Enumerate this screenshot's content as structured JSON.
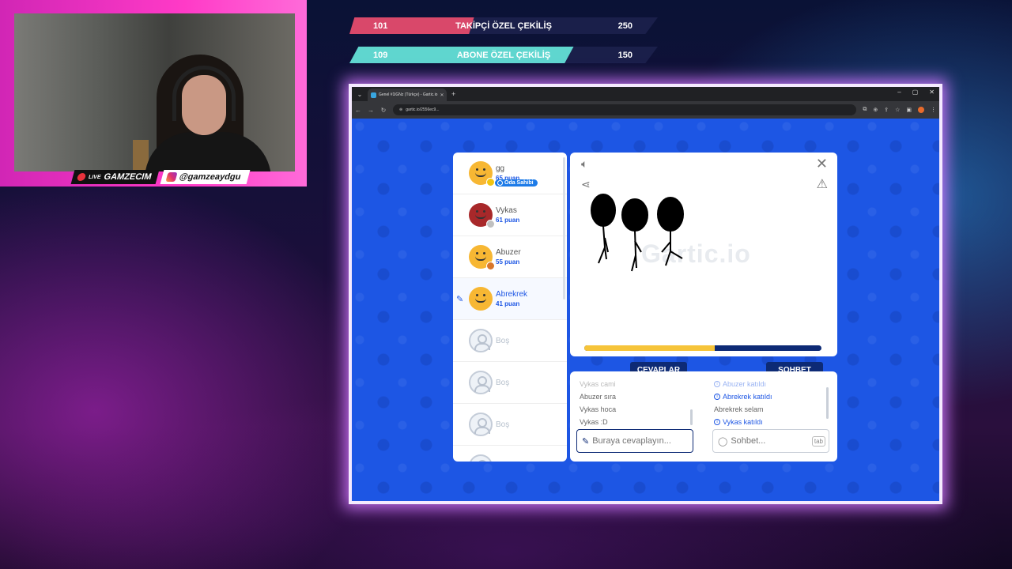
{
  "webcam": {
    "streamer_name": "GAMZECIM",
    "live_label": "LIVE",
    "instagram_handle": "@gamzeaydgu"
  },
  "ribbons": [
    {
      "left_value": "101",
      "title": "TAKİPÇİ ÖZEL ÇEKİLİŞ",
      "right_value": "250",
      "color": "#d9486a",
      "progress": 0.404
    },
    {
      "left_value": "109",
      "title": "ABONE ÖZEL ÇEKİLİŞ",
      "right_value": "150",
      "color": "#5fd6cf",
      "progress": 0.727
    }
  ],
  "browser": {
    "tab_title": "Genel #1lGNz (Türkçe) - Gartic.io",
    "url": "gartic.io/2556ec9..."
  },
  "players": [
    {
      "name": "gg",
      "score": "65 puan",
      "avatar_color": "#f7b733",
      "badge_color": "#f2c511",
      "owner_label": "Oda Sahibi"
    },
    {
      "name": "Vykas",
      "score": "61 puan",
      "avatar_color": "#a8282a",
      "badge_color": "#c0c0c0"
    },
    {
      "name": "Abuzer",
      "score": "55 puan",
      "avatar_color": "#f7b733",
      "badge_color": "#d9772a"
    },
    {
      "name": "Abrekrek",
      "score": "41 puan",
      "avatar_color": "#f7b733",
      "badge_color": "#f7b733"
    }
  ],
  "empty_slots": [
    "Boş",
    "Boş",
    "Boş"
  ],
  "canvas": {
    "watermark": "Gartic.io",
    "timer_progress": 0.55
  },
  "tabs": {
    "answers": "CEVAPLAR",
    "chat": "SOHBET"
  },
  "answers": {
    "lines": [
      "Vykas cami",
      "Abuzer sıra",
      "Vykas hoca",
      "Vykas :D"
    ],
    "placeholder": "Buraya cevaplayın..."
  },
  "chat": {
    "lines": [
      {
        "text": "Abuzer katıldı",
        "system": true
      },
      {
        "text": "Abrekrek katıldı",
        "system": true
      },
      {
        "text": "Abrekrek selam",
        "system": false
      },
      {
        "text": "Vykas katıldı",
        "system": true
      }
    ],
    "placeholder": "Sohbet...",
    "tab_key": "tab"
  }
}
